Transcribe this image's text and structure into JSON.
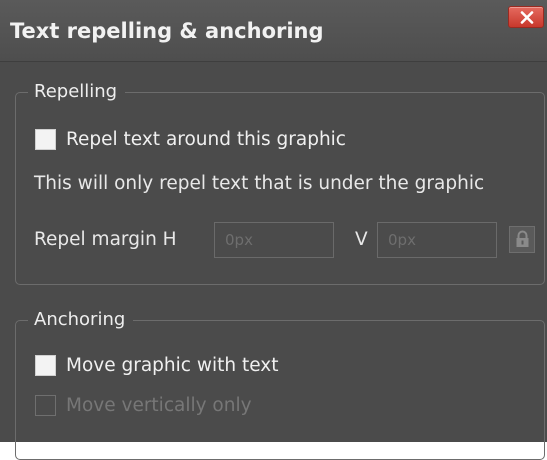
{
  "dialog": {
    "title": "Text repelling & anchoring",
    "close_icon": "close-icon"
  },
  "repelling": {
    "legend": "Repelling",
    "repel_checkbox": {
      "label": "Repel text around this graphic",
      "checked": false
    },
    "info_text": "This will only repel text that is under the graphic",
    "margin_label": "Repel margin H",
    "margin_h": {
      "value": "",
      "placeholder": "0px"
    },
    "v_label": "V",
    "margin_v": {
      "value": "",
      "placeholder": "0px"
    },
    "lock_icon": "lock-icon"
  },
  "anchoring": {
    "legend": "Anchoring",
    "move_checkbox": {
      "label": "Move graphic with text",
      "checked": false
    },
    "vertical_checkbox": {
      "label": "Move vertically only",
      "checked": false,
      "disabled": true
    }
  },
  "colors": {
    "background": "#4b4b4b",
    "close_button": "#d9483c"
  }
}
